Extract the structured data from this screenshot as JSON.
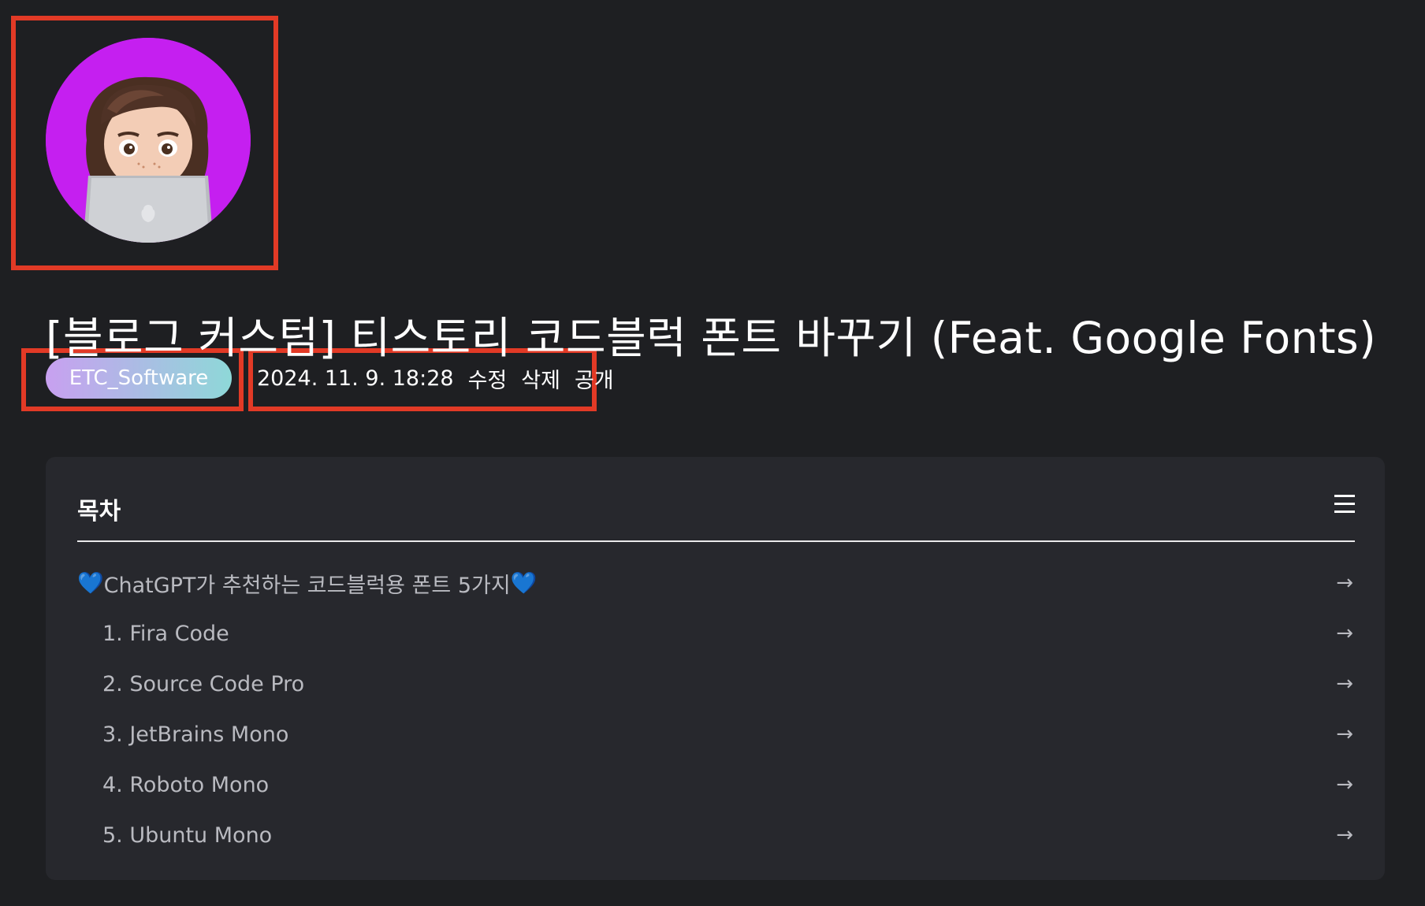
{
  "post": {
    "title": "[블로그 커스텀] 티스토리 코드블럭 폰트 바꾸기 (Feat. Google Fonts)",
    "category": "ETC_Software",
    "date": "2024. 11. 9. 18:28",
    "actions": {
      "edit": "수정",
      "delete": "삭제",
      "visibility": "공개"
    }
  },
  "toc": {
    "title": "목차",
    "menu_icon": "hamburger-menu-icon",
    "items": [
      {
        "label": "ChatGPT가 추천하는 코드블럭용 폰트 5가지",
        "level": 1
      },
      {
        "label": "1. Fira Code",
        "level": 2
      },
      {
        "label": "2. Source Code Pro",
        "level": 2
      },
      {
        "label": "3. JetBrains Mono",
        "level": 2
      },
      {
        "label": "4. Roboto Mono",
        "level": 2
      },
      {
        "label": "5. Ubuntu Mono",
        "level": 2
      }
    ],
    "arrow_icon": "arrow-right-icon",
    "heart_icon": "blue-heart-icon"
  },
  "colors": {
    "background": "#1e1f22",
    "toc_background": "#27282d",
    "highlight_border": "#e23a26",
    "avatar_background": "#c51ff0",
    "pill_gradient_start": "#c8a0f0",
    "pill_gradient_end": "#8ed8d8"
  }
}
